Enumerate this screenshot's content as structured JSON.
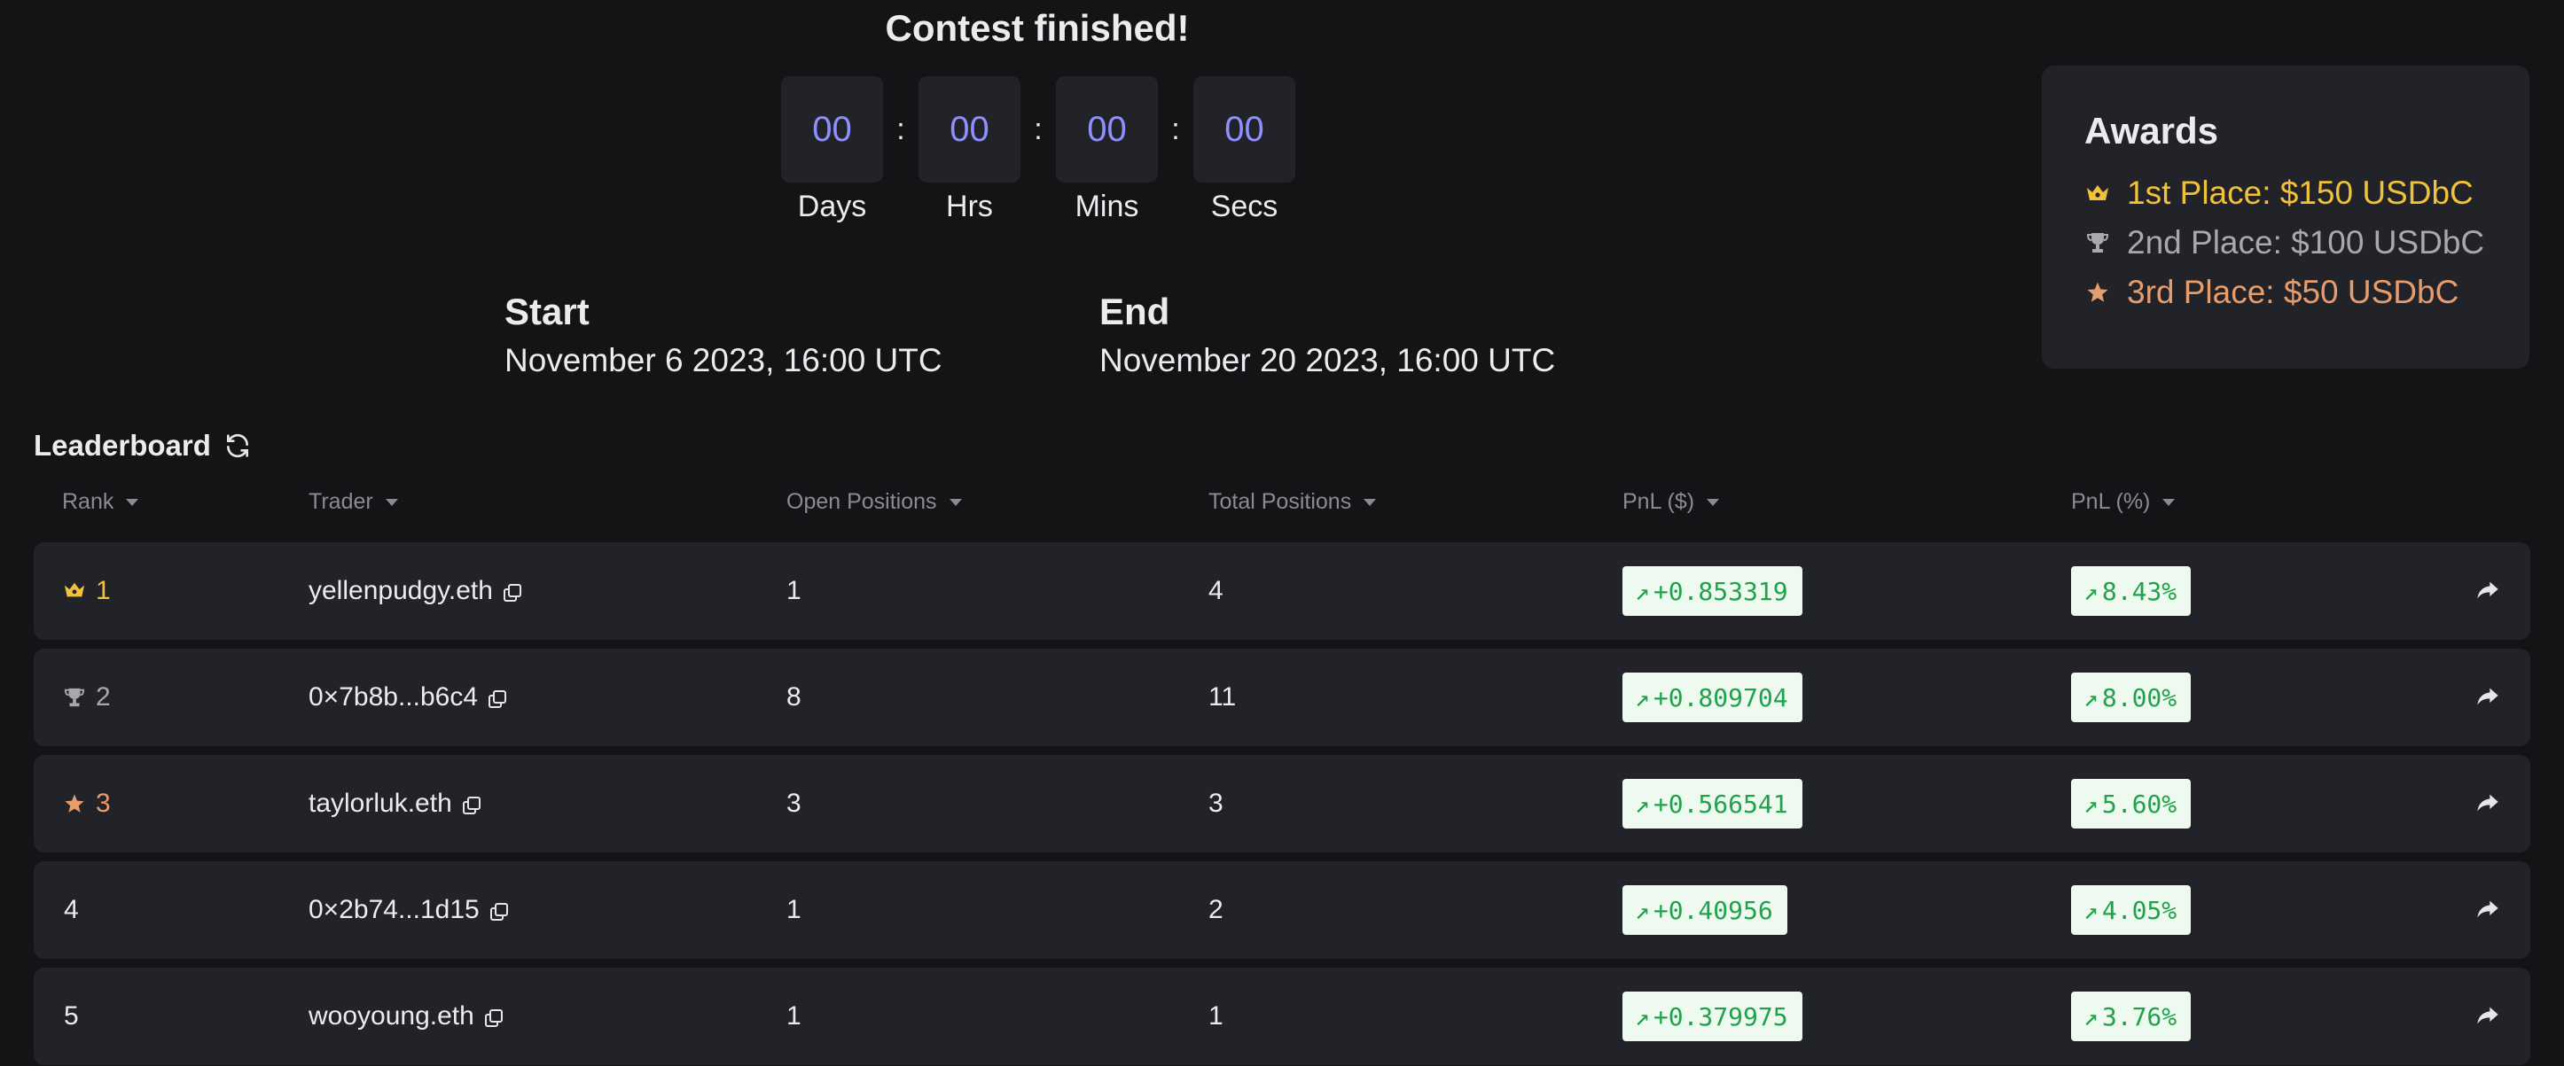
{
  "contest": {
    "status_title": "Contest finished!",
    "countdown": [
      {
        "value": "00",
        "label": "Days"
      },
      {
        "value": "00",
        "label": "Hrs"
      },
      {
        "value": "00",
        "label": "Mins"
      },
      {
        "value": "00",
        "label": "Secs"
      }
    ],
    "separator": ":",
    "start": {
      "label": "Start",
      "value": "November 6 2023, 16:00 UTC"
    },
    "end": {
      "label": "End",
      "value": "November 20 2023, 16:00 UTC"
    }
  },
  "awards": {
    "title": "Awards",
    "items": [
      {
        "icon": "crown-icon",
        "text": "1st Place: $150 USDbC",
        "color": "#f1c13a"
      },
      {
        "icon": "trophy-icon",
        "text": "2nd Place: $100 USDbC",
        "color": "#a8a8ae"
      },
      {
        "icon": "star-icon",
        "text": "3rd Place: $50 USDbC",
        "color": "#e79c6c"
      }
    ]
  },
  "leaderboard": {
    "title": "Leaderboard",
    "columns": [
      "Rank",
      "Trader",
      "Open Positions",
      "Total Positions",
      "PnL ($)",
      "PnL (%)"
    ],
    "rows": [
      {
        "rank": "1",
        "trader": "yellenpudgy.eth",
        "open": "1",
        "total": "4",
        "pnl_usd": "+0.853319",
        "pnl_pct": "8.43%"
      },
      {
        "rank": "2",
        "trader": "0×7b8b...b6c4",
        "open": "8",
        "total": "11",
        "pnl_usd": "+0.809704",
        "pnl_pct": "8.00%"
      },
      {
        "rank": "3",
        "trader": "taylorluk.eth",
        "open": "3",
        "total": "3",
        "pnl_usd": "+0.566541",
        "pnl_pct": "5.60%"
      },
      {
        "rank": "4",
        "trader": "0×2b74...1d15",
        "open": "1",
        "total": "2",
        "pnl_usd": "+0.40956",
        "pnl_pct": "4.05%"
      },
      {
        "rank": "5",
        "trader": "wooyoung.eth",
        "open": "1",
        "total": "1",
        "pnl_usd": "+0.379975",
        "pnl_pct": "3.76%"
      }
    ]
  },
  "colors": {
    "accent": "#8f90ff",
    "positive": "#1fa34a",
    "positive_bg": "#eefaf0",
    "card": "#222329",
    "background": "#141417"
  }
}
